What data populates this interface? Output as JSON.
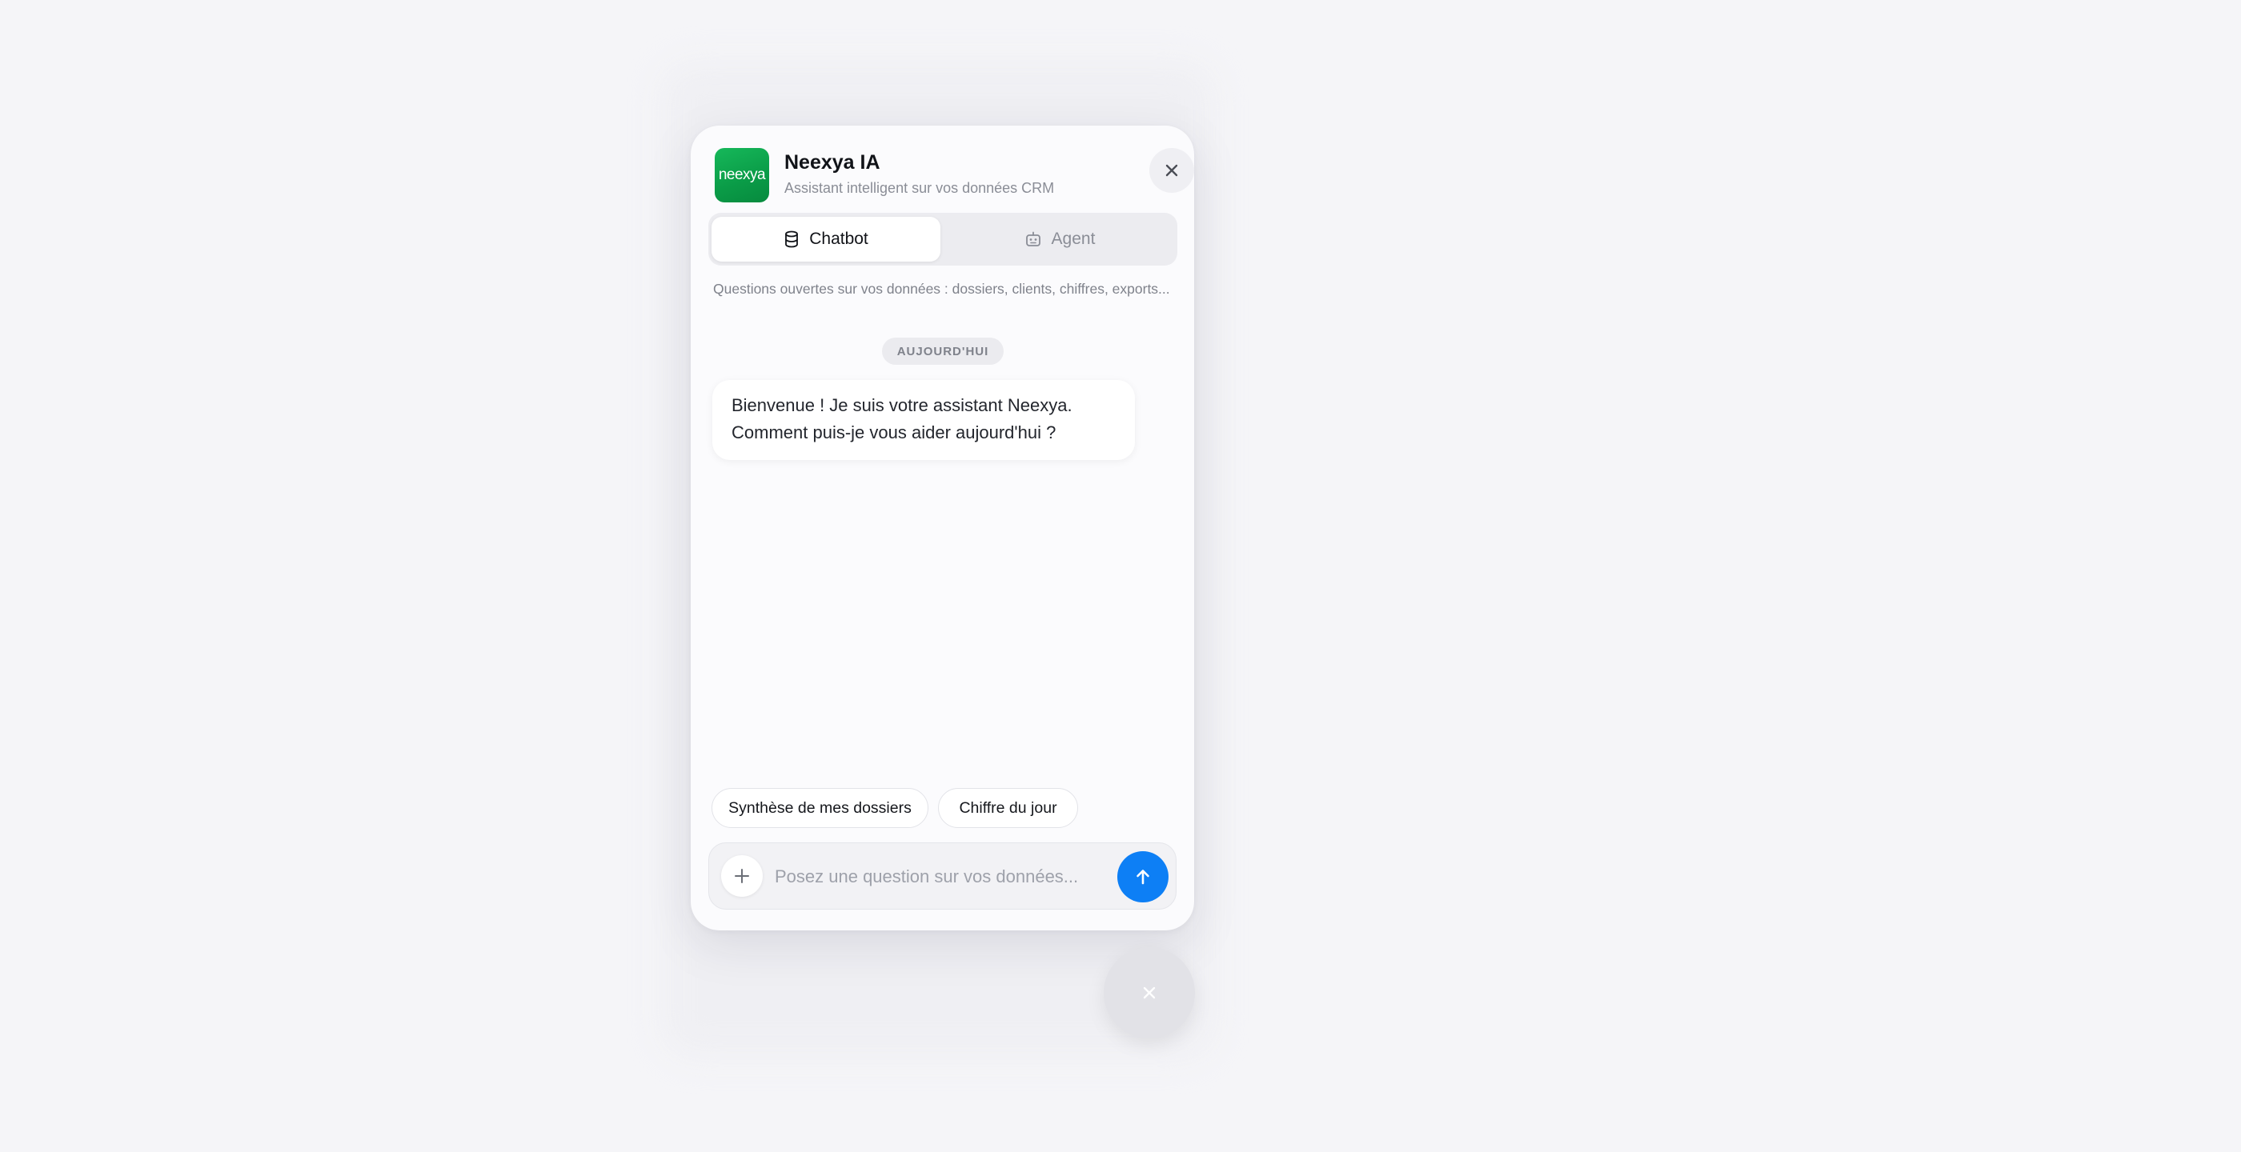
{
  "widget": {
    "logo_text": "neexya",
    "title": "Neexya IA",
    "subtitle": "Assistant intelligent sur vos données CRM",
    "close_icon": "close-icon"
  },
  "tabs": [
    {
      "label": "Chatbot",
      "icon": "database-icon",
      "active": true
    },
    {
      "label": "Agent",
      "icon": "robot-icon",
      "active": false
    }
  ],
  "hint": "Questions ouvertes sur vos données : dossiers, clients, chiffres, exports...",
  "conversation": {
    "date_separator": "AUJOURD'HUI",
    "messages": [
      {
        "from": "assistant",
        "lines": [
          "Bienvenue ! Je suis votre assistant Neexya.",
          "Comment puis-je vous aider aujourd'hui ?"
        ]
      }
    ]
  },
  "suggestions": [
    "Synthèse de mes dossiers",
    "Chiffre du jour"
  ],
  "composer": {
    "placeholder": "Posez une question sur vos données...",
    "value": "",
    "attach_icon": "plus-icon",
    "send_icon": "arrow-up-icon"
  },
  "fab": {
    "icon": "close-icon"
  },
  "colors": {
    "brand_green": "#0a9b47",
    "send_blue": "#0d7ff5",
    "background": "#f5f5f8"
  }
}
